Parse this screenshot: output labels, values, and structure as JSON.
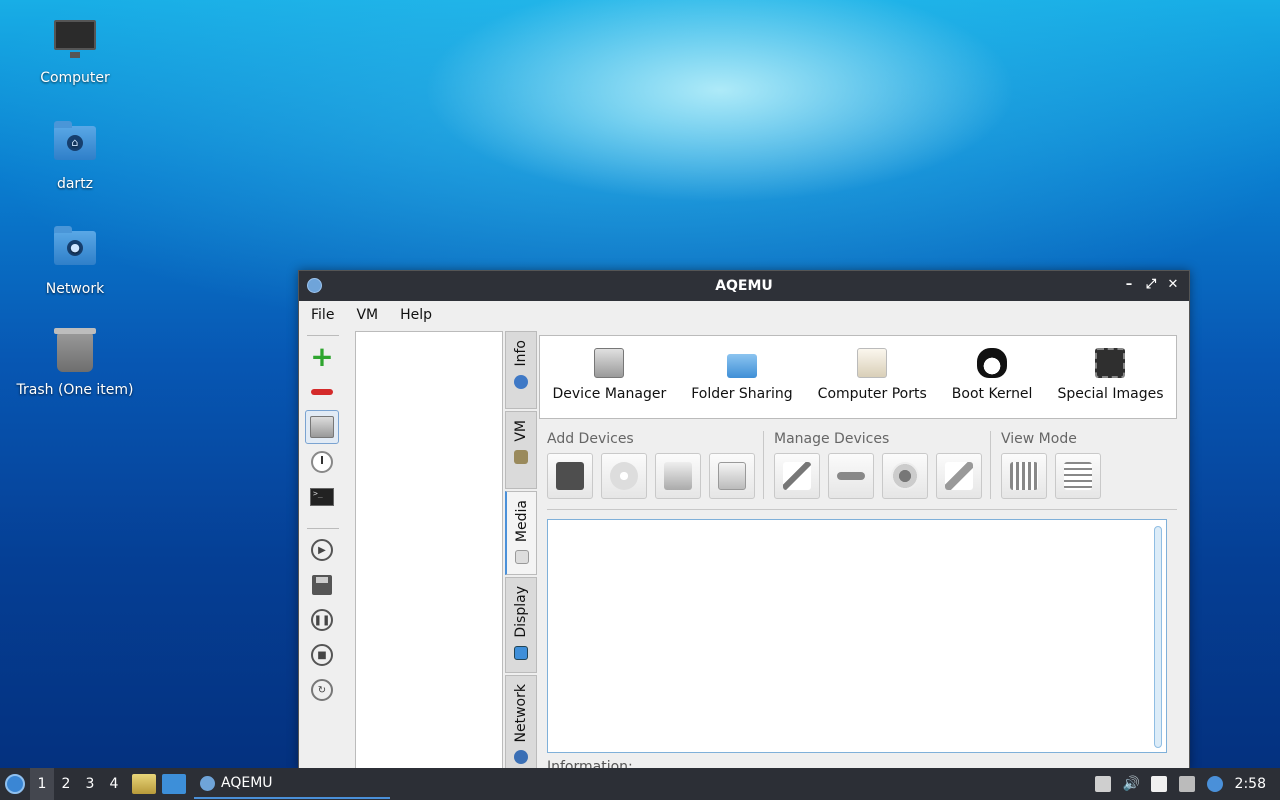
{
  "desktop": {
    "icons": [
      {
        "label": "Computer"
      },
      {
        "label": "dartz"
      },
      {
        "label": "Network"
      },
      {
        "label": "Trash (One item)"
      }
    ]
  },
  "window": {
    "title": "AQEMU",
    "controls": {
      "minimize": "–",
      "maximize": "⤢",
      "close": "✕"
    }
  },
  "menu": {
    "file": "File",
    "vm": "VM",
    "help": "Help"
  },
  "vtabs": [
    "Info",
    "VM",
    "Media",
    "Display",
    "Network"
  ],
  "top_panel": [
    {
      "label": "Device Manager",
      "icon": "hard-disk-icon"
    },
    {
      "label": "Folder Sharing",
      "icon": "folder-icon"
    },
    {
      "label": "Computer Ports",
      "icon": "usb-icon"
    },
    {
      "label": "Boot Kernel",
      "icon": "tux-icon"
    },
    {
      "label": "Special Images",
      "icon": "chip-icon"
    }
  ],
  "groups": {
    "add_devices": "Add Devices",
    "manage_devices": "Manage Devices",
    "view_mode": "View Mode"
  },
  "info_label": "Information:",
  "taskbar": {
    "workspaces": [
      "1",
      "2",
      "3",
      "4"
    ],
    "task_label": "AQEMU",
    "clock": "2:58"
  }
}
